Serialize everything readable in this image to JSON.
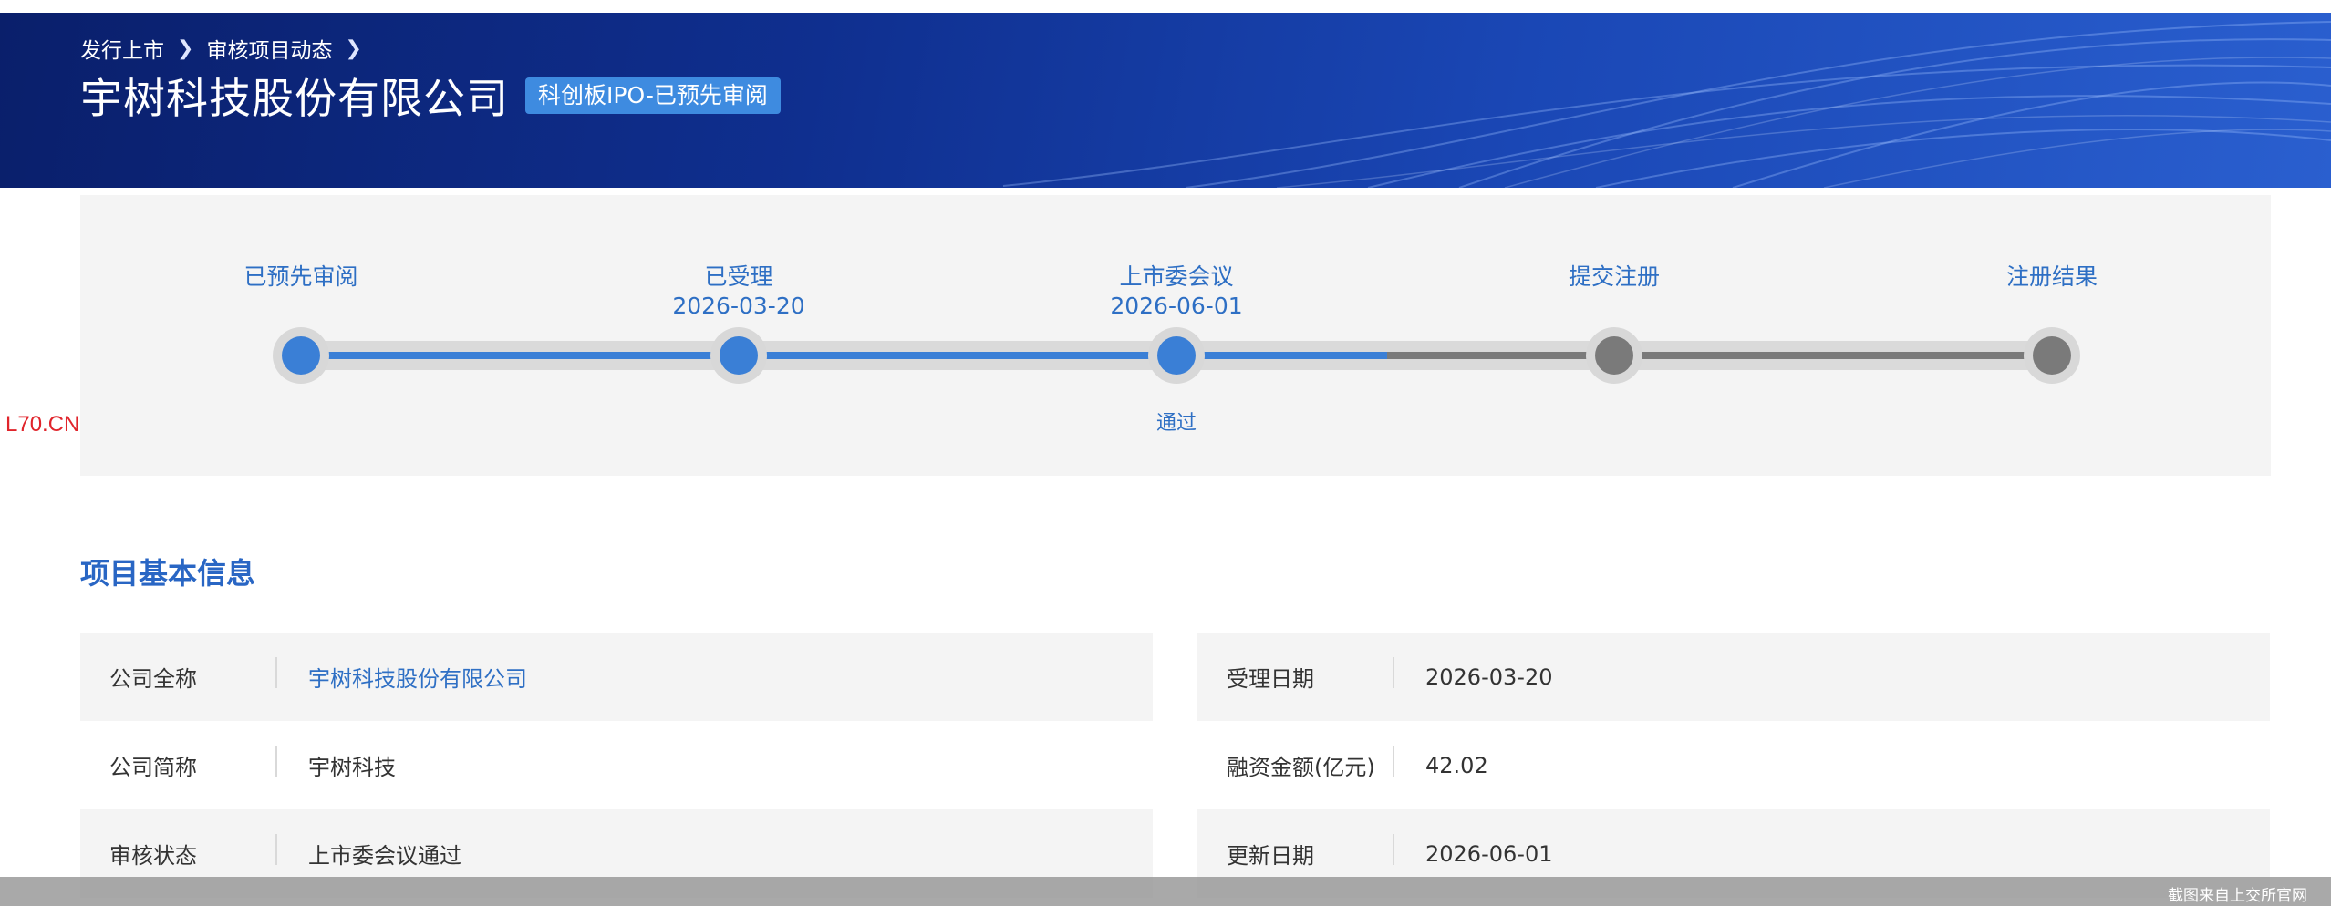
{
  "breadcrumb": {
    "item1": "发行上市",
    "item2": "审核项目动态"
  },
  "header": {
    "company_name": "宇树科技股份有限公司",
    "status_tag": "科创板IPO-已预先审阅"
  },
  "watermark": "L70.CN",
  "progress": {
    "steps": [
      {
        "label": "已预先审阅",
        "date": "",
        "state": "done"
      },
      {
        "label": "已受理",
        "date": "2026-03-20",
        "state": "done"
      },
      {
        "label": "上市委会议",
        "date": "2026-06-01",
        "state": "done",
        "result": "通过"
      },
      {
        "label": "提交注册",
        "date": "",
        "state": "todo"
      },
      {
        "label": "注册结果",
        "date": "",
        "state": "todo"
      }
    ],
    "fill_fraction": 0.61
  },
  "section": {
    "title": "项目基本信息"
  },
  "info_left": [
    {
      "key": "公司全称",
      "value": "宇树科技股份有限公司"
    },
    {
      "key": "公司简称",
      "value": "宇树科技"
    },
    {
      "key": "审核状态",
      "value": "上市委会议通过"
    }
  ],
  "info_right": [
    {
      "key": "受理日期",
      "value": "2026-03-20"
    },
    {
      "key": "融资金额(亿元)",
      "value": "42.02"
    },
    {
      "key": "更新日期",
      "value": "2026-06-01"
    }
  ],
  "footer": {
    "note": "截图来自上交所官网"
  },
  "colors": {
    "accent": "#3a7fd6",
    "link": "#2e6fc4",
    "banner": "#0f2f8f",
    "watermark": "#e0242b"
  },
  "icons": {
    "breadcrumb_separator": "chevron-right-icon"
  }
}
